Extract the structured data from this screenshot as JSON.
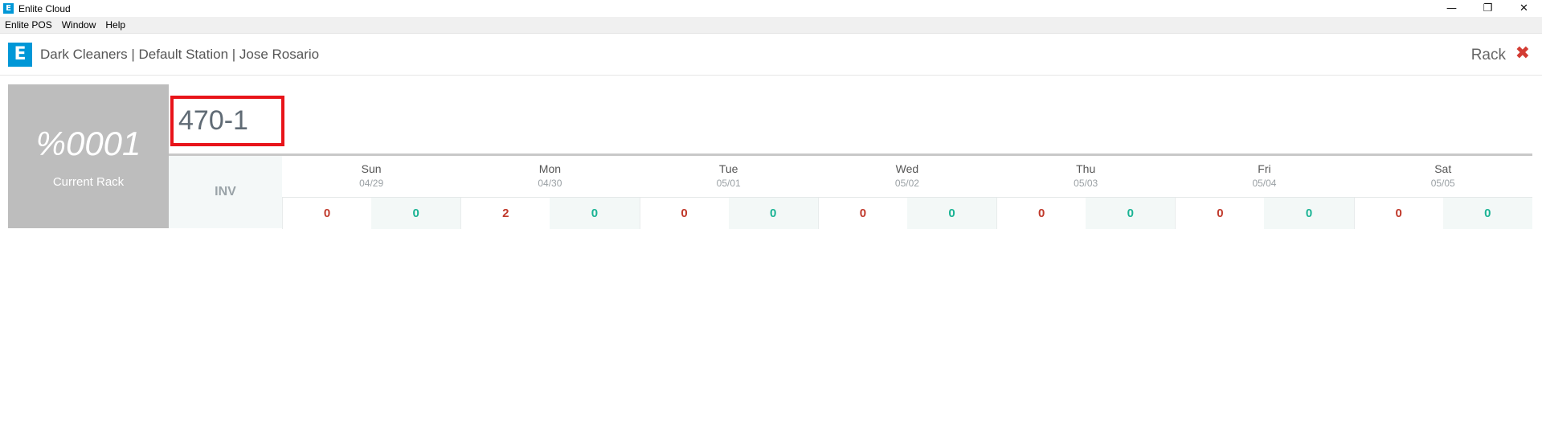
{
  "window": {
    "title": "Enlite Cloud",
    "icon_letter": "E",
    "minimize": "—",
    "restore": "❐",
    "close": "✕"
  },
  "menu": [
    "Enlite POS",
    "Window",
    "Help"
  ],
  "header": {
    "logo_letter": "E",
    "title": "Dark Cleaners | Default Station | Jose Rosario",
    "section": "Rack",
    "close_glyph": "✖",
    "accent": "#0097d7",
    "close_color": "#d33c33"
  },
  "rack": {
    "code": "%0001",
    "caption": "Current Rack",
    "input_value": "470-1"
  },
  "inv_label": "INV",
  "days": [
    {
      "name": "Sun",
      "date": "04/29",
      "red": "0",
      "green": "0"
    },
    {
      "name": "Mon",
      "date": "04/30",
      "red": "2",
      "green": "0"
    },
    {
      "name": "Tue",
      "date": "05/01",
      "red": "0",
      "green": "0"
    },
    {
      "name": "Wed",
      "date": "05/02",
      "red": "0",
      "green": "0"
    },
    {
      "name": "Thu",
      "date": "05/03",
      "red": "0",
      "green": "0"
    },
    {
      "name": "Fri",
      "date": "05/04",
      "red": "0",
      "green": "0"
    },
    {
      "name": "Sat",
      "date": "05/05",
      "red": "0",
      "green": "0"
    }
  ]
}
